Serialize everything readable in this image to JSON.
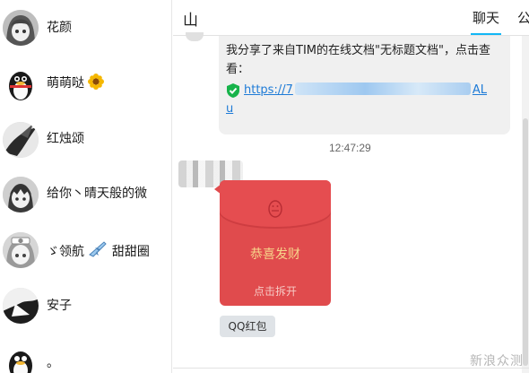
{
  "sidebar": {
    "contacts": [
      {
        "name": "花颜",
        "avatar_icon": "anime-girl-avatar-icon"
      },
      {
        "name": "萌萌哒",
        "avatar_icon": "qq-penguin-avatar-icon",
        "emoji": "sunflower-icon"
      },
      {
        "name": "红烛颂",
        "avatar_icon": "bird-avatar-icon"
      },
      {
        "name": "给你丶晴天般的微",
        "avatar_icon": "anime-boy-avatar-icon"
      },
      {
        "name": "ゞ领航",
        "name_suffix": "甜甜圈",
        "avatar_icon": "anime-nurse-avatar-icon",
        "emoji": "airplane-icon"
      },
      {
        "name": "安子",
        "avatar_icon": "silhouette-avatar-icon"
      },
      {
        "name": "。",
        "avatar_icon": "qq-penguin-avatar-icon"
      }
    ]
  },
  "header": {
    "title": "山",
    "tabs": [
      {
        "label": "聊天",
        "active": true
      },
      {
        "label": "公"
      }
    ]
  },
  "chat": {
    "shared_doc_message": {
      "line1": "我分享了来自TIM的在线文档\"无标题文档\"，点击查",
      "line2": "看：",
      "link_start": "https://7",
      "link_end": "AL",
      "link_line2": "u"
    },
    "timestamp": "12:47:29",
    "red_packet": {
      "greeting": "恭喜发财",
      "action": "点击拆开",
      "tag": "QQ红包"
    }
  },
  "watermark": "新浪众测",
  "colors": {
    "accent": "#12b7f5",
    "link": "#1e7bd7",
    "red_packet": "#e04b4d",
    "greeting_gold": "#f7d58a"
  }
}
